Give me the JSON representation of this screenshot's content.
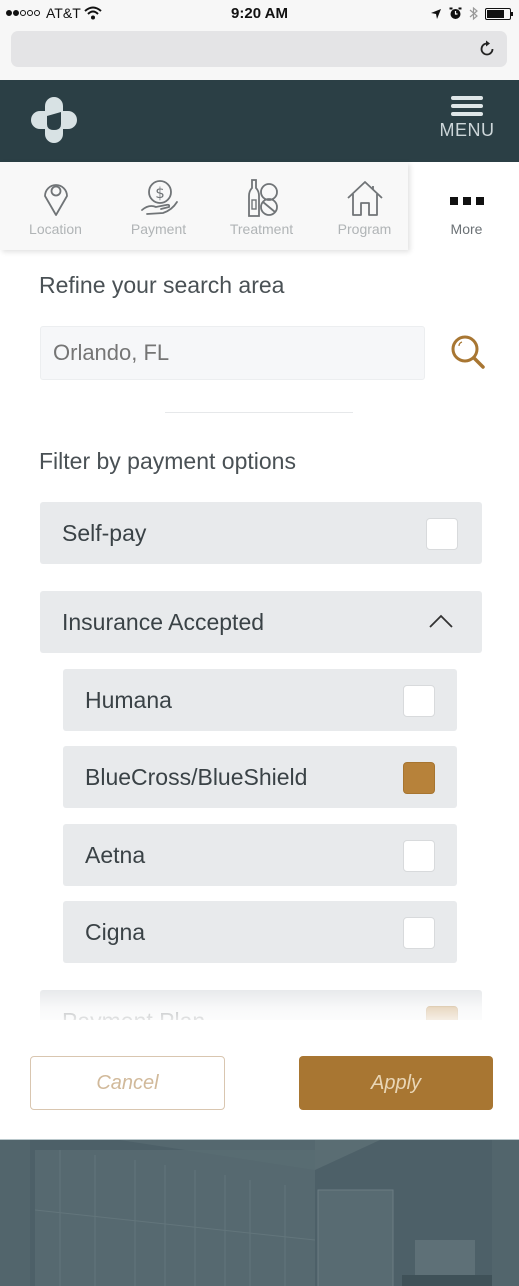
{
  "status_bar": {
    "carrier": "AT&T",
    "time": "9:20 AM",
    "signal_bars_filled": 2,
    "signal_bars_total": 5,
    "battery_level_percent": 75,
    "icons": [
      "wifi-icon",
      "location-arrow-icon",
      "alarm-icon",
      "bluetooth-icon",
      "battery-icon"
    ]
  },
  "browser": {
    "url": "",
    "reload_icon": "reload-icon"
  },
  "header": {
    "logo_icon": "cross-logo-icon",
    "menu_label": "MENU",
    "colors": {
      "background": "#2b3f45",
      "foreground": "#dfe6e8"
    }
  },
  "tabs": [
    {
      "label": "Location",
      "icon": "map-pin-icon",
      "active": false
    },
    {
      "label": "Payment",
      "icon": "hand-dollar-icon",
      "active": false
    },
    {
      "label": "Treatment",
      "icon": "bottle-pill-icon",
      "active": false
    },
    {
      "label": "Program",
      "icon": "house-icon",
      "active": false
    },
    {
      "label": "More",
      "icon": "more-dots-icon",
      "active": true
    }
  ],
  "search": {
    "title": "Refine your search area",
    "placeholder": "Orlando, FL",
    "value": "",
    "button_icon": "search-icon"
  },
  "filters": {
    "title": "Filter by payment options",
    "accent_color": "#b7823a",
    "options": [
      {
        "label": "Self-pay",
        "checked": false
      },
      {
        "label": "Insurance Accepted",
        "expanded": true,
        "children": [
          {
            "label": "Humana",
            "checked": false
          },
          {
            "label": "BlueCross/BlueShield",
            "checked": true
          },
          {
            "label": "Aetna",
            "checked": false
          },
          {
            "label": "Cigna",
            "checked": false
          }
        ]
      },
      {
        "label": "Payment Plan",
        "checked": true
      }
    ]
  },
  "actions": {
    "cancel_label": "Cancel",
    "apply_label": "Apply"
  }
}
